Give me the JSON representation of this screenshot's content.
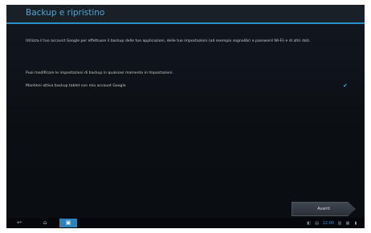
{
  "header": {
    "title": "Backup e ripristino"
  },
  "content": {
    "description": "Utilizza il tuo account Google per effettuare il backup delle tue applicazioni, delle tue impostazioni (ad esempio segnalibri e password Wi-Fi) e di altri dati.",
    "modify_text": "Puoi modificare le impostazioni di backup in qualsiasi momento in Impostazioni.",
    "backup_option": {
      "label": "Mantieni attivo backup tablet con mio account Google",
      "checked": true
    }
  },
  "actions": {
    "next_label": "Avanti"
  },
  "navbar": {
    "back_icon": "↩",
    "home_icon": "⌂",
    "recent_icon": "▣",
    "status_icons": [
      "◧",
      "▤",
      "▥",
      "▦",
      "▮"
    ],
    "time": "12:00"
  },
  "colors": {
    "accent": "#2b91c9",
    "title": "#4fa7d6",
    "background": "#0b0f14"
  }
}
